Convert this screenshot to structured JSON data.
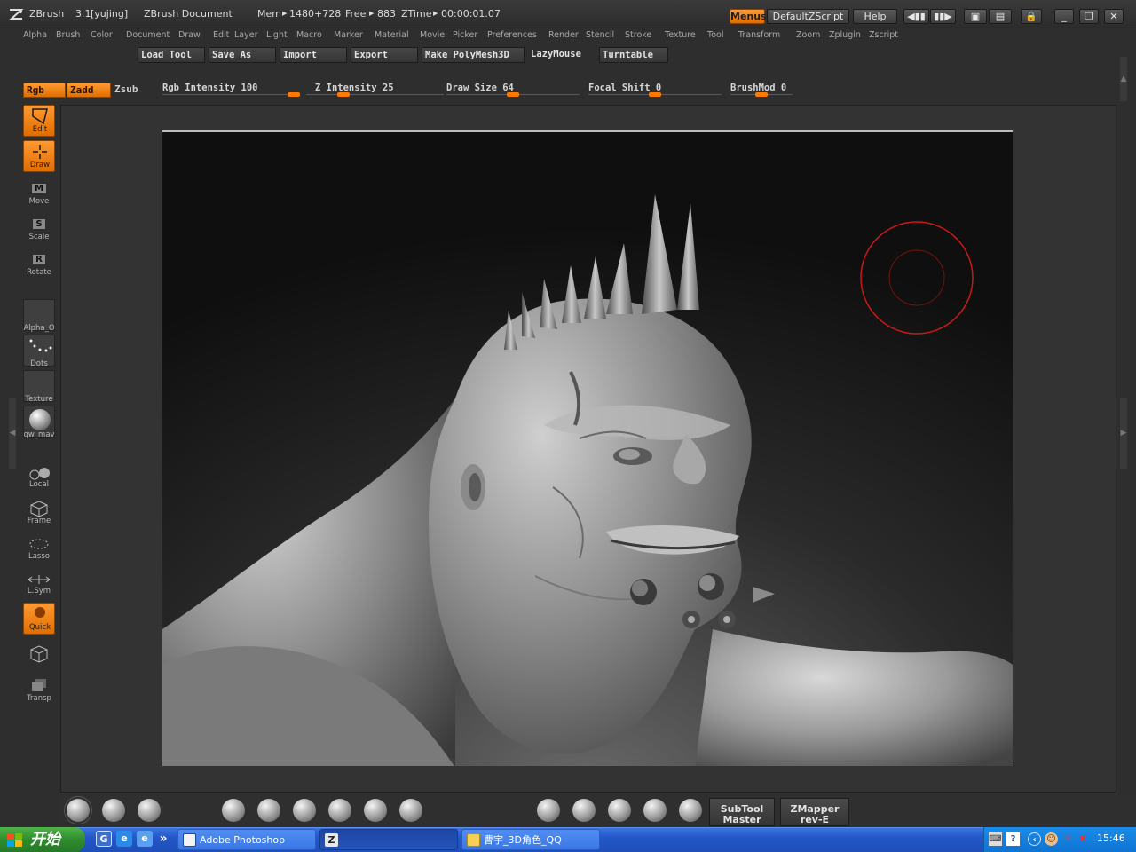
{
  "app": {
    "name": "ZBrush",
    "version": "3.1",
    "user": "[yujing]",
    "document": "ZBrush Document",
    "mem_label": "Mem",
    "mem_value": "1480+728",
    "free_label": "Free",
    "free_value": "883",
    "ztime_label": "ZTime",
    "ztime_value": "00:00:01.07"
  },
  "titlebar_buttons": {
    "menus": "Menus",
    "default_zscript": "DefaultZScript",
    "help": "Help"
  },
  "menus": [
    "Alpha",
    "Brush",
    "Color",
    "Document",
    "Draw",
    "Edit",
    "Layer",
    "Light",
    "Macro",
    "Marker",
    "Material",
    "Movie",
    "Picker",
    "Preferences",
    "Render",
    "Stencil",
    "Stroke",
    "Texture",
    "Tool",
    "Transform",
    "Zoom",
    "Zplugin",
    "Zscript"
  ],
  "file_buttons": [
    "Load Tool",
    "Save As",
    "Import",
    "Export",
    "Make PolyMesh3D",
    "LazyMouse",
    "Turntable"
  ],
  "draw_modes": {
    "rgb": "Rgb",
    "zadd": "Zadd",
    "zsub": "Zsub"
  },
  "sliders": [
    {
      "label": "Rgb Intensity",
      "value": "100",
      "fraction": 1.0
    },
    {
      "label": "Z Intensity",
      "value": "25",
      "fraction": 0.25
    },
    {
      "label": "Draw Size",
      "value": "64",
      "fraction": 0.5
    },
    {
      "label": "Focal Shift",
      "value": "0",
      "fraction": 0.5
    },
    {
      "label": "BrushMod",
      "value": "0",
      "fraction": 0.5
    }
  ],
  "left_shelf": {
    "edit": "Edit",
    "draw": "Draw",
    "move": "Move",
    "move_key": "M",
    "scale": "Scale",
    "scale_key": "S",
    "rotate": "Rotate",
    "rotate_key": "R",
    "alpha": "Alpha_O",
    "dots": "Dots",
    "texture": "Texture",
    "material": "qw_mav",
    "local": "Local",
    "frame": "Frame",
    "lasso": "Lasso",
    "lsym": "L.Sym",
    "quick": "Quick",
    "transp": "Transp"
  },
  "bottom_tray": {
    "subtool_line1": "SubTool",
    "subtool_line2": "Master",
    "zmapper_line1": "ZMapper",
    "zmapper_line2": "rev-E"
  },
  "taskbar": {
    "start": "开始",
    "tasks": [
      {
        "label": "Adobe Photoshop",
        "state": "inactive"
      },
      {
        "label": "",
        "state": "active"
      },
      {
        "label": "曹宇_3D角色_QQ",
        "state": "inactive"
      }
    ],
    "clock": "15:46",
    "chevron": "»"
  },
  "colors": {
    "accent_orange": "#ff8a1a",
    "brush_cursor": "#c81818",
    "taskbar_blue": "#2357c7",
    "start_green": "#2f8c2b"
  }
}
